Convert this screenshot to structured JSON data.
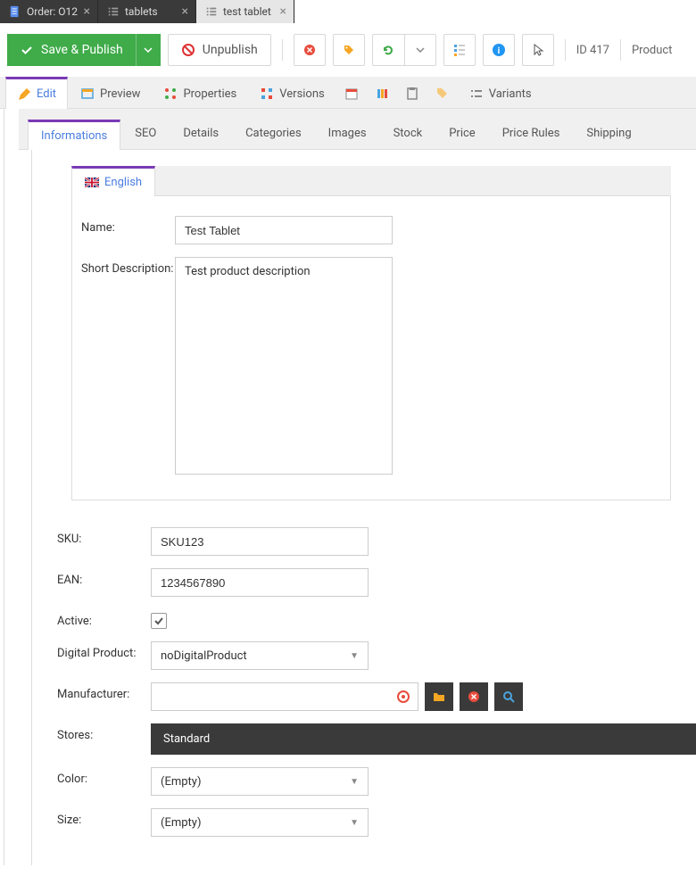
{
  "docTabs": [
    {
      "label": "Order: O12",
      "icon": "doc-blue",
      "active": false
    },
    {
      "label": "tablets",
      "icon": "list-grey",
      "active": false
    },
    {
      "label": "test tablet",
      "icon": "list-grey",
      "active": true
    }
  ],
  "toolbar": {
    "save": "Save & Publish",
    "unpublish": "Unpublish",
    "id": "ID 417",
    "product": "Product"
  },
  "mainTabs": [
    {
      "label": "Edit",
      "active": true
    },
    {
      "label": "Preview"
    },
    {
      "label": "Properties"
    },
    {
      "label": "Versions"
    },
    {
      "label": "Variants"
    }
  ],
  "subTabs": [
    "Informations",
    "SEO",
    "Details",
    "Categories",
    "Images",
    "Stock",
    "Price",
    "Price Rules",
    "Shipping"
  ],
  "subTabActive": 0,
  "lang": {
    "label": "English"
  },
  "fields": {
    "nameLabel": "Name:",
    "name": "Test Tablet",
    "shortDescLabel": "Short Description:",
    "shortDesc": "Test product description",
    "skuLabel": "SKU:",
    "sku": "SKU123",
    "eanLabel": "EAN:",
    "ean": "1234567890",
    "activeLabel": "Active:",
    "digitalLabel": "Digital Product:",
    "digital": "noDigitalProduct",
    "manufacturerLabel": "Manufacturer:",
    "manufacturer": "",
    "storesLabel": "Stores:",
    "stores": "Standard",
    "colorLabel": "Color:",
    "color": "(Empty)",
    "sizeLabel": "Size:",
    "size": "(Empty)"
  }
}
